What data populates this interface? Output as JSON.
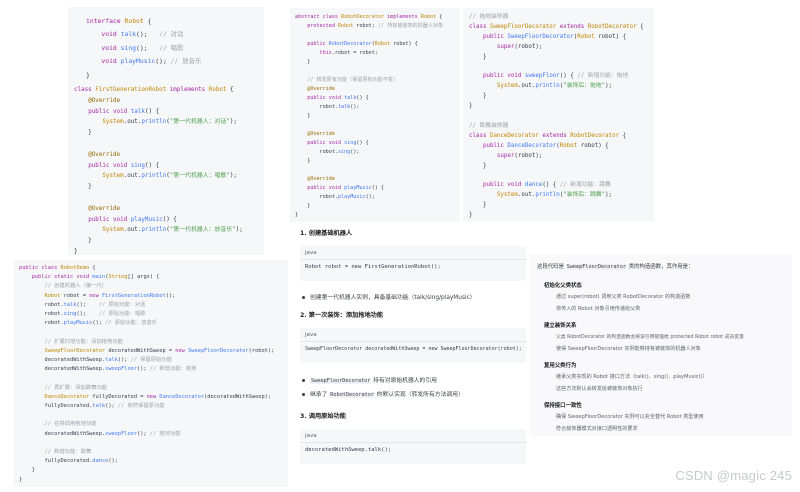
{
  "interface_panel": {
    "lines": [
      "interface Robot {",
      "    void talk();   // 对话",
      "    void sing();   // 唱歌",
      "    void playMusic(); // 放音乐",
      "}"
    ]
  },
  "first_gen_panel": {
    "lines": [
      "class FirstGenerationRobot implements Robot {",
      "    @Override",
      "    public void talk() {",
      "        System.out.println(\"第一代机器人：对话\");",
      "    }",
      "",
      "    @Override",
      "    public void sing() {",
      "        System.out.println(\"第一代机器人：唱歌\");",
      "    }",
      "",
      "    @Override",
      "    public void playMusic() {",
      "        System.out.println(\"第一代机器人：放音乐\");",
      "    }",
      "}"
    ]
  },
  "demo_panel": {
    "lines": [
      "public class RobotDemo {",
      "    public static void main(String[] args) {",
      "        // 创建机器人（第一代）",
      "        Robot robot = new FirstGenerationRobot();",
      "        robot.talk();    // 原始功能：对话",
      "        robot.sing();    // 原始功能：唱歌",
      "        robot.playMusic(); // 原始功能：放音乐",
      "",
      "        // 扩展扫地功能：添加拖地功能",
      "        SweepFloorDecorator decoratedWithSweep = new SweepFloorDecorator(robot);",
      "        decoratedWithSweep.talk(); // 保留原始功能",
      "        decoratedWithSweep.sweepFloor(); // 新增功能：拖地",
      "",
      "        // 再扩展：添加跳舞功能",
      "        DanceDecorator fullyDecorated = new DanceDecorator(decoratedWithSweep);",
      "        fullyDecorated.talk(); // 依然保留原功能",
      "",
      "        // 在将调用拖地功能",
      "        decoratedWithSweep.sweepFloor(); // 拖地功能",
      "",
      "        // 新增功能：跳舞",
      "        fullyDecorated.dance();",
      "    }",
      "}"
    ]
  },
  "abstract_panel": {
    "lines": [
      "abstract class RobotDecorator implements Robot {",
      "    protected Robot robot; // 持有被装饰的机器人对象",
      "",
      "    public RobotDecorator(Robot robot) {",
      "        this.robot = robot;",
      "    }",
      "",
      "    // 转发原有功能（保留原有功能不变）",
      "    @Override",
      "    public void talk() {",
      "        robot.talk();",
      "    }",
      "",
      "    @Override",
      "    public void sing() {",
      "        robot.sing();",
      "    }",
      "",
      "    @Override",
      "    public void playMusic() {",
      "        robot.playMusic();",
      "    }",
      "}"
    ]
  },
  "concrete_panel": {
    "lines": [
      "// 拖地装饰器",
      "class SweepFloorDecorator extends RobotDecorator {",
      "    public SweepFloorDecorator(Robot robot) {",
      "        super(robot);",
      "    }",
      "",
      "    public void sweepFloor() { // 新增功能：拖地",
      "        System.out.println(\"装饰后：拖地\");",
      "    }",
      "}",
      "",
      "// 跳舞装饰器",
      "class DanceDecorator extends RobotDecorator {",
      "    public DanceDecorator(Robot robot) {",
      "        super(robot);",
      "    }",
      "",
      "    public void dance() { // 新增功能：跳舞",
      "        System.out.println(\"装饰后：跳舞\");",
      "    }",
      "}"
    ]
  },
  "article": {
    "step1_heading": "1. 创建基础机器人",
    "code_lang": "java",
    "step1_code": "Robot robot = new FirstGenerationRobot();",
    "step1_bullet": "创建第一代机器人实例，具备基础功能（talk/sing/playMusic）",
    "step2_heading": "2. 第一次装饰：添加拖地功能",
    "step2_code": "SweepFloorDecorator decoratedWithSweep = new SweepFloorDecorator(robot);",
    "step2_bullet1_tag": "SweepFloorDecorator",
    "step2_bullet1_text": " 持有对原始机器人的引用",
    "step2_bullet2_pre": "继承了 ",
    "step2_bullet2_tag": "RobotDecorator",
    "step2_bullet2_post": " 的默认实现（转发所有方法调用）",
    "step3_heading": "3. 调用原始功能",
    "step3_code": "decoratedWithSweep.talk();"
  },
  "note": {
    "intro_pre": "这段代码是 ",
    "intro_tag": "SweepFloorDecorator",
    "intro_post": " 类的构造函数，其作用是：",
    "items": [
      {
        "title": "初始化父类状态",
        "subs": [
          "通过 super(robot) 调用父类 RobotDecorator 的构造函数",
          "将传入的 Robot 对象引用传递给父类"
        ]
      },
      {
        "title": "建立装饰关系",
        "subs": [
          "父类 RobotDecorator 的构造函数会将该引用赋值给 protected Robot robot 成员变量",
          "使得 SweepFloorDecorator 实例能够持有被装饰的机器人对象"
        ]
      },
      {
        "title": "复用父类行为",
        "subs": [
          "继承父类实现的 Robot 接口方法（talk()、sing()、playMusic()）",
          "这些方法默认会转发给被装饰对象执行"
        ]
      },
      {
        "title": "保持接口一致性",
        "subs": [
          "确保 SweepFloorDecorator 实例可以完全替代 Robot 类型使用",
          "符合装饰器模式对接口透明性的要求"
        ]
      }
    ]
  },
  "watermark": "CSDN @magic 245"
}
